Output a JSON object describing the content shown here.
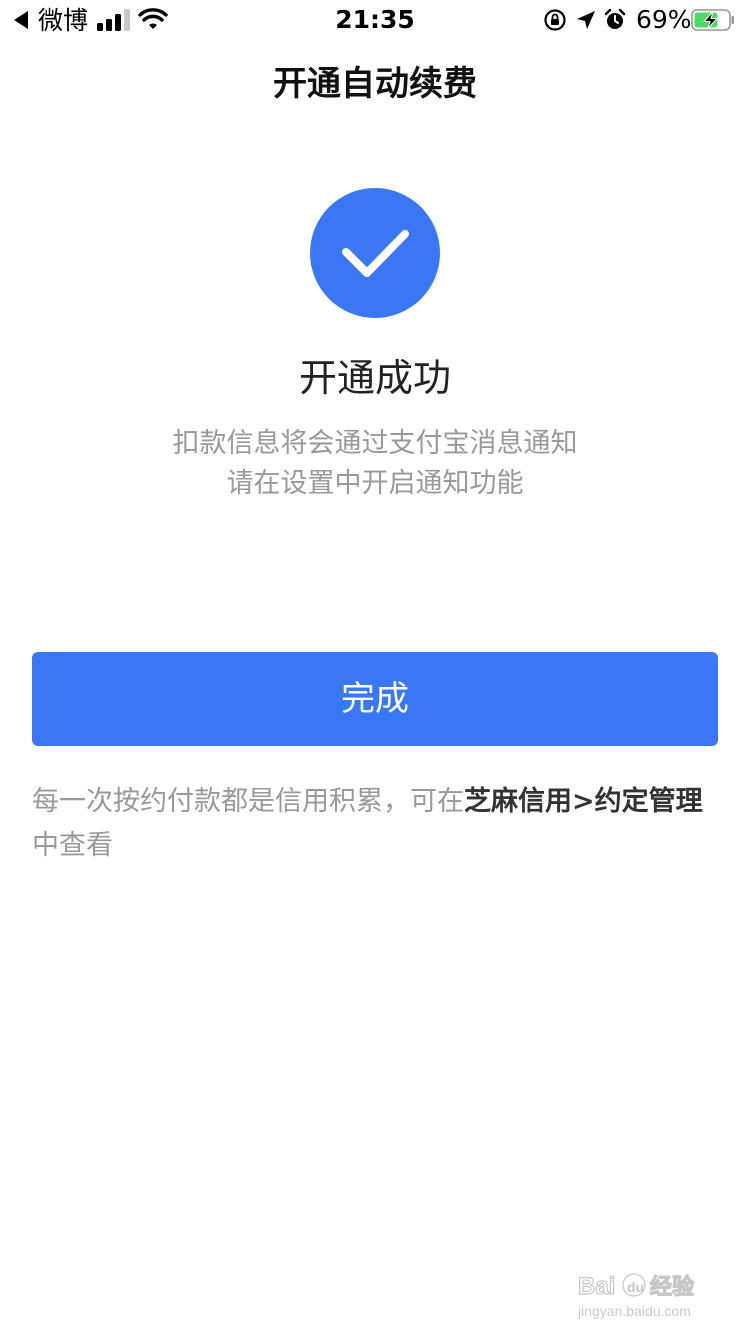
{
  "status_bar": {
    "back_app": "微博",
    "time": "21:35",
    "battery": "69%",
    "icons": [
      "back-arrow-icon",
      "signal-icon",
      "wifi-icon",
      "orientation-lock-icon",
      "location-icon",
      "alarm-icon",
      "battery-charging-icon"
    ]
  },
  "nav": {
    "title": "开通自动续费"
  },
  "result": {
    "icon": "checkmark-icon",
    "title": "开通成功",
    "desc_line1": "扣款信息将会通过支付宝消息通知",
    "desc_line2": "请在设置中开启通知功能"
  },
  "actions": {
    "done_label": "完成"
  },
  "footer": {
    "note_prefix": "每一次按约付款都是信用积累，可在",
    "note_link": "芝麻信用>约定管理",
    "note_suffix": "中查看"
  },
  "watermark": {
    "logo_text": "Bai du 经验",
    "url_text": "jingyan.baidu.com"
  },
  "colors": {
    "primary": "#3a77f5",
    "muted_text": "#999999",
    "link_text": "#333333"
  }
}
